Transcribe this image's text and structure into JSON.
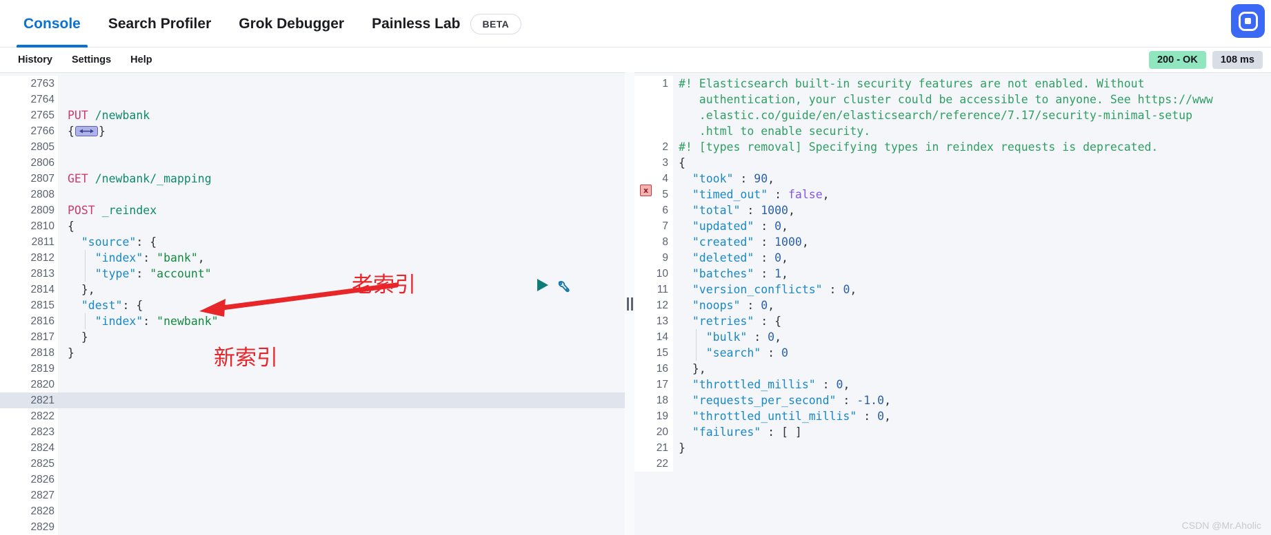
{
  "header": {
    "tabs": [
      {
        "label": "Console",
        "active": true
      },
      {
        "label": "Search Profiler",
        "active": false
      },
      {
        "label": "Grok Debugger",
        "active": false
      },
      {
        "label": "Painless Lab",
        "active": false
      }
    ],
    "beta_label": "BETA",
    "logo_icon": "elastic-app-icon"
  },
  "submenu": {
    "items": [
      "History",
      "Settings",
      "Help"
    ],
    "status_code": "200 - OK",
    "latency": "108 ms"
  },
  "editor": {
    "actions": {
      "play_icon": "play-triangle-icon",
      "wrench_icon": "wrench-icon"
    },
    "active_line": "2821",
    "lines": [
      {
        "n": "2763",
        "fold": "",
        "text": ""
      },
      {
        "n": "2764",
        "fold": "",
        "text": ""
      },
      {
        "n": "2765",
        "fold": "",
        "method": "PUT",
        "url": "/newbank"
      },
      {
        "n": "2766",
        "fold": "▸",
        "collapsed": true,
        "prefix": "{",
        "suffix": "}"
      },
      {
        "n": "2805",
        "fold": "",
        "text": ""
      },
      {
        "n": "2806",
        "fold": "",
        "text": ""
      },
      {
        "n": "2807",
        "fold": "",
        "method": "GET",
        "url": "/newbank/_mapping"
      },
      {
        "n": "2808",
        "fold": "",
        "text": ""
      },
      {
        "n": "2809",
        "fold": "",
        "method": "POST",
        "url": "_reindex"
      },
      {
        "n": "2810",
        "fold": "▾",
        "text": "{"
      },
      {
        "n": "2811",
        "fold": "▾",
        "key": "\"source\"",
        "rest": ": {",
        "indent": 1
      },
      {
        "n": "2812",
        "fold": "",
        "key": "\"index\"",
        "rest": ": ",
        "str": "\"bank\"",
        "tail": ",",
        "indent": 2
      },
      {
        "n": "2813",
        "fold": "",
        "key": "\"type\"",
        "rest": ": ",
        "str": "\"account\"",
        "tail": "",
        "indent": 2
      },
      {
        "n": "2814",
        "fold": "▴",
        "text": "  },",
        "indent": 1
      },
      {
        "n": "2815",
        "fold": "▾",
        "key": "\"dest\"",
        "rest": ": {",
        "indent": 1
      },
      {
        "n": "2816",
        "fold": "",
        "key": "\"index\"",
        "rest": ": ",
        "str": "\"newbank\"",
        "tail": "",
        "indent": 2
      },
      {
        "n": "2817",
        "fold": "▴",
        "text": "  }",
        "indent": 1
      },
      {
        "n": "2818",
        "fold": "▴",
        "text": "}"
      },
      {
        "n": "2819",
        "fold": "",
        "text": ""
      },
      {
        "n": "2820",
        "fold": "",
        "text": ""
      },
      {
        "n": "2821",
        "fold": "",
        "text": ""
      },
      {
        "n": "2822",
        "fold": "",
        "text": ""
      },
      {
        "n": "2823",
        "fold": "",
        "text": ""
      },
      {
        "n": "2824",
        "fold": "",
        "text": ""
      },
      {
        "n": "2825",
        "fold": "",
        "text": ""
      },
      {
        "n": "2826",
        "fold": "",
        "text": ""
      },
      {
        "n": "2827",
        "fold": "",
        "text": ""
      },
      {
        "n": "2828",
        "fold": "",
        "text": ""
      },
      {
        "n": "2829",
        "fold": "",
        "text": ""
      }
    ],
    "annotations": [
      {
        "text": "老索引",
        "name": "annotation-old-index"
      },
      {
        "text": "新索引",
        "name": "annotation-new-index"
      }
    ]
  },
  "output": {
    "error_marker": "x",
    "warning_1": {
      "n": "1",
      "parts": [
        "#! Elasticsearch built-in security features are not enabled. Without",
        "   authentication, your cluster could be accessible to anyone. See https://www",
        "   .elastic.co/guide/en/elasticsearch/reference/7.17/security-minimal-setup",
        "   .html to enable security."
      ]
    },
    "warning_2": {
      "n": "2",
      "text": "#! [types removal] Specifying types in reindex requests is deprecated."
    },
    "lines": [
      {
        "n": "3",
        "fold": "▾",
        "text": "{"
      },
      {
        "n": "4",
        "fold": "",
        "key": "\"took\"",
        "sep": " : ",
        "num": "90",
        "tail": ",",
        "indent": 1
      },
      {
        "n": "5",
        "fold": "",
        "key": "\"timed_out\"",
        "sep": " : ",
        "bool": "false",
        "tail": ",",
        "indent": 1
      },
      {
        "n": "6",
        "fold": "",
        "key": "\"total\"",
        "sep": " : ",
        "num": "1000",
        "tail": ",",
        "indent": 1
      },
      {
        "n": "7",
        "fold": "",
        "key": "\"updated\"",
        "sep": " : ",
        "num": "0",
        "tail": ",",
        "indent": 1
      },
      {
        "n": "8",
        "fold": "",
        "key": "\"created\"",
        "sep": " : ",
        "num": "1000",
        "tail": ",",
        "indent": 1
      },
      {
        "n": "9",
        "fold": "",
        "key": "\"deleted\"",
        "sep": " : ",
        "num": "0",
        "tail": ",",
        "indent": 1
      },
      {
        "n": "10",
        "fold": "",
        "key": "\"batches\"",
        "sep": " : ",
        "num": "1",
        "tail": ",",
        "indent": 1
      },
      {
        "n": "11",
        "fold": "",
        "key": "\"version_conflicts\"",
        "sep": " : ",
        "num": "0",
        "tail": ",",
        "indent": 1
      },
      {
        "n": "12",
        "fold": "",
        "key": "\"noops\"",
        "sep": " : ",
        "num": "0",
        "tail": ",",
        "indent": 1
      },
      {
        "n": "13",
        "fold": "▾",
        "key": "\"retries\"",
        "sep": " : {",
        "indent": 1
      },
      {
        "n": "14",
        "fold": "",
        "key": "\"bulk\"",
        "sep": " : ",
        "num": "0",
        "tail": ",",
        "indent": 2
      },
      {
        "n": "15",
        "fold": "",
        "key": "\"search\"",
        "sep": " : ",
        "num": "0",
        "tail": "",
        "indent": 2
      },
      {
        "n": "16",
        "fold": "▴",
        "text": "  },",
        "indent": 1
      },
      {
        "n": "17",
        "fold": "",
        "key": "\"throttled_millis\"",
        "sep": " : ",
        "num": "0",
        "tail": ",",
        "indent": 1
      },
      {
        "n": "18",
        "fold": "",
        "key": "\"requests_per_second\"",
        "sep": " : ",
        "num": "-1.0",
        "tail": ",",
        "indent": 1
      },
      {
        "n": "19",
        "fold": "",
        "key": "\"throttled_until_millis\"",
        "sep": " : ",
        "num": "0",
        "tail": ",",
        "indent": 1
      },
      {
        "n": "20",
        "fold": "",
        "key": "\"failures\"",
        "sep": " : [ ]",
        "indent": 1
      },
      {
        "n": "21",
        "fold": "▴",
        "text": "}"
      },
      {
        "n": "22",
        "fold": "",
        "text": ""
      }
    ]
  },
  "splitter": {
    "icon": "drag-handle-icon"
  },
  "watermark": "CSDN @Mr.Aholic"
}
